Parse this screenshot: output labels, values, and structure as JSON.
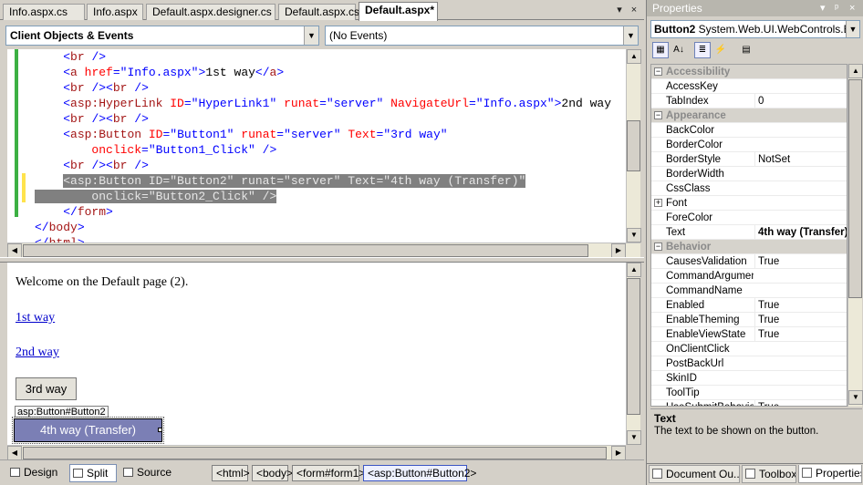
{
  "doc_tabs": [
    {
      "label": "Info.aspx.cs",
      "active": false
    },
    {
      "label": "Info.aspx",
      "active": false
    },
    {
      "label": "Default.aspx.designer.cs",
      "active": false
    },
    {
      "label": "Default.aspx.cs",
      "active": false
    },
    {
      "label": "Default.aspx*",
      "active": true
    }
  ],
  "tab_controls": {
    "dropdown": "▾",
    "close": "×"
  },
  "object_combo": {
    "value": "Client Objects & Events"
  },
  "event_combo": {
    "value": "(No Events)"
  },
  "code_lines": [
    {
      "indent": "    ",
      "parts": [
        {
          "t": "<",
          "c": "brk"
        },
        {
          "t": "br",
          "c": "tagc"
        },
        {
          "t": " />",
          "c": "brk"
        }
      ]
    },
    {
      "indent": "    ",
      "parts": [
        {
          "t": "<",
          "c": "brk"
        },
        {
          "t": "a",
          "c": "tagc"
        },
        {
          "t": " href",
          "c": "attr"
        },
        {
          "t": "=",
          "c": "brk"
        },
        {
          "t": "\"Info.aspx\"",
          "c": "val"
        },
        {
          "t": ">",
          "c": "brk"
        },
        {
          "t": "1st way",
          "c": ""
        },
        {
          "t": "</",
          "c": "brk"
        },
        {
          "t": "a",
          "c": "tagc"
        },
        {
          "t": ">",
          "c": "brk"
        }
      ]
    },
    {
      "indent": "    ",
      "parts": [
        {
          "t": "<",
          "c": "brk"
        },
        {
          "t": "br",
          "c": "tagc"
        },
        {
          "t": " /><",
          "c": "brk"
        },
        {
          "t": "br",
          "c": "tagc"
        },
        {
          "t": " />",
          "c": "brk"
        }
      ]
    },
    {
      "indent": "    ",
      "parts": [
        {
          "t": "<",
          "c": "brk"
        },
        {
          "t": "asp:HyperLink",
          "c": "tagc"
        },
        {
          "t": " ID",
          "c": "attr"
        },
        {
          "t": "=",
          "c": "brk"
        },
        {
          "t": "\"HyperLink1\"",
          "c": "val"
        },
        {
          "t": " runat",
          "c": "attr"
        },
        {
          "t": "=",
          "c": "brk"
        },
        {
          "t": "\"server\"",
          "c": "val"
        },
        {
          "t": " NavigateUrl",
          "c": "attr"
        },
        {
          "t": "=",
          "c": "brk"
        },
        {
          "t": "\"Info.aspx\"",
          "c": "val"
        },
        {
          "t": ">",
          "c": "brk"
        },
        {
          "t": "2nd way",
          "c": ""
        }
      ]
    },
    {
      "indent": "    ",
      "parts": [
        {
          "t": "<",
          "c": "brk"
        },
        {
          "t": "br",
          "c": "tagc"
        },
        {
          "t": " /><",
          "c": "brk"
        },
        {
          "t": "br",
          "c": "tagc"
        },
        {
          "t": " />",
          "c": "brk"
        }
      ]
    },
    {
      "indent": "    ",
      "parts": [
        {
          "t": "<",
          "c": "brk"
        },
        {
          "t": "asp:Button",
          "c": "tagc"
        },
        {
          "t": " ID",
          "c": "attr"
        },
        {
          "t": "=",
          "c": "brk"
        },
        {
          "t": "\"Button1\"",
          "c": "val"
        },
        {
          "t": " runat",
          "c": "attr"
        },
        {
          "t": "=",
          "c": "brk"
        },
        {
          "t": "\"server\"",
          "c": "val"
        },
        {
          "t": " Text",
          "c": "attr"
        },
        {
          "t": "=",
          "c": "brk"
        },
        {
          "t": "\"3rd way\"",
          "c": "val"
        }
      ]
    },
    {
      "indent": "        ",
      "parts": [
        {
          "t": "onclick",
          "c": "attr"
        },
        {
          "t": "=",
          "c": "brk"
        },
        {
          "t": "\"Button1_Click\"",
          "c": "val"
        },
        {
          "t": " />",
          "c": "brk"
        }
      ]
    },
    {
      "indent": "    ",
      "parts": [
        {
          "t": "<",
          "c": "brk"
        },
        {
          "t": "br",
          "c": "tagc"
        },
        {
          "t": " /><",
          "c": "brk"
        },
        {
          "t": "br",
          "c": "tagc"
        },
        {
          "t": " />",
          "c": "brk"
        }
      ]
    },
    {
      "indent": "    ",
      "selected": true,
      "parts": [
        {
          "t": "<asp:Button ID=\"Button2\" runat=\"server\" Text=\"4th way (Transfer)\"",
          "c": "sel"
        }
      ]
    },
    {
      "indent": "",
      "selected": true,
      "parts": [
        {
          "t": "        onclick=\"Button2_Click\" />",
          "c": "sel"
        }
      ]
    },
    {
      "indent": "    ",
      "parts": [
        {
          "t": "</",
          "c": "brk"
        },
        {
          "t": "form",
          "c": "tagc"
        },
        {
          "t": ">",
          "c": "brk"
        }
      ]
    },
    {
      "indent": "",
      "parts": [
        {
          "t": "</",
          "c": "brk"
        },
        {
          "t": "body",
          "c": "tagc"
        },
        {
          "t": ">",
          "c": "brk"
        }
      ]
    },
    {
      "indent": "",
      "parts": [
        {
          "t": "</",
          "c": "brk"
        },
        {
          "t": "html",
          "c": "tagc"
        },
        {
          "t": ">",
          "c": "brk"
        }
      ]
    }
  ],
  "design": {
    "welcome": "Welcome on the Default page (2).",
    "link1": "1st way",
    "link2": "2nd way",
    "button3": "3rd way",
    "button4_tag": "asp:Button#Button2",
    "button4": "4th way (Transfer)"
  },
  "view_buttons": [
    {
      "label": "Design",
      "icon": "design-view-icon",
      "on": false
    },
    {
      "label": "Split",
      "icon": "split-view-icon",
      "on": true
    },
    {
      "label": "Source",
      "icon": "source-view-icon",
      "on": false
    }
  ],
  "breadcrumbs": [
    {
      "label": "<html>",
      "current": false
    },
    {
      "label": "<body>",
      "current": false
    },
    {
      "label": "<form#form1>",
      "current": false
    },
    {
      "label": "<asp:Button#Button2>",
      "current": true
    }
  ],
  "properties": {
    "title": "Properties",
    "title_controls": [
      "▾",
      "ᵖ",
      "×"
    ],
    "object_name": "Button2",
    "object_type": "System.Web.UI.WebControls.Button",
    "toolbar": [
      {
        "name": "categorized-icon",
        "glyph": "▦",
        "on": true
      },
      {
        "name": "alphabetical-icon",
        "glyph": "A↓",
        "on": false
      },
      {
        "name": "properties-icon",
        "glyph": "≣",
        "on": true
      },
      {
        "name": "events-icon",
        "glyph": "⚡",
        "on": false
      },
      {
        "name": "property-pages-icon",
        "glyph": "▤",
        "on": false
      }
    ],
    "rows": [
      {
        "cat": true,
        "name": "Accessibility",
        "exp": "−"
      },
      {
        "name": "AccessKey",
        "value": ""
      },
      {
        "name": "TabIndex",
        "value": "0"
      },
      {
        "cat": true,
        "name": "Appearance",
        "exp": "−"
      },
      {
        "name": "BackColor",
        "value": ""
      },
      {
        "name": "BorderColor",
        "value": ""
      },
      {
        "name": "BorderStyle",
        "value": "NotSet"
      },
      {
        "name": "BorderWidth",
        "value": ""
      },
      {
        "name": "CssClass",
        "value": ""
      },
      {
        "name": "Font",
        "value": "",
        "exp": "+"
      },
      {
        "name": "ForeColor",
        "value": ""
      },
      {
        "name": "Text",
        "value": "4th way (Transfer)",
        "bold": true
      },
      {
        "cat": true,
        "name": "Behavior",
        "exp": "−"
      },
      {
        "name": "CausesValidation",
        "value": "True"
      },
      {
        "name": "CommandArgument",
        "value": ""
      },
      {
        "name": "CommandName",
        "value": ""
      },
      {
        "name": "Enabled",
        "value": "True"
      },
      {
        "name": "EnableTheming",
        "value": "True"
      },
      {
        "name": "EnableViewState",
        "value": "True"
      },
      {
        "name": "OnClientClick",
        "value": ""
      },
      {
        "name": "PostBackUrl",
        "value": ""
      },
      {
        "name": "SkinID",
        "value": ""
      },
      {
        "name": "ToolTip",
        "value": ""
      },
      {
        "name": "UseSubmitBehavior",
        "value": "True"
      }
    ],
    "desc_title": "Text",
    "desc_text": "The text to be shown on the button."
  },
  "bottom_tabs": [
    {
      "label": "Document Ou...",
      "icon": "document-outline-icon",
      "on": false
    },
    {
      "label": "Toolbox",
      "icon": "toolbox-icon",
      "on": false
    },
    {
      "label": "Properties",
      "icon": "properties-tab-icon",
      "on": true
    }
  ],
  "scroll_glyphs": {
    "up": "▲",
    "down": "▼",
    "left": "◀",
    "right": "▶"
  }
}
